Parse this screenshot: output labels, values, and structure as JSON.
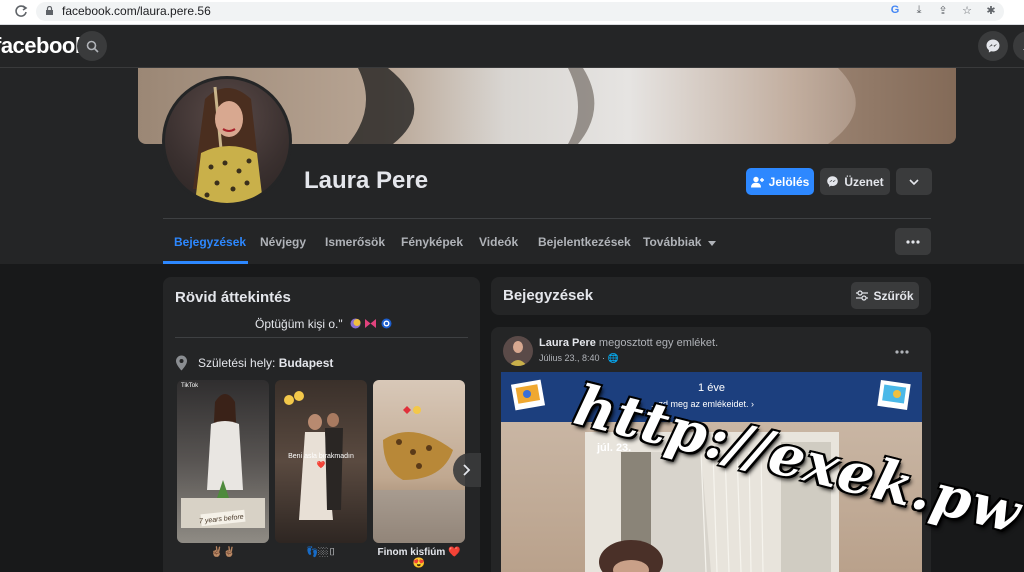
{
  "browser": {
    "url": "facebook.com/laura.pere.56",
    "icons": [
      "google-g-icon",
      "download-icon",
      "share-icon",
      "star-icon",
      "extension-icon"
    ]
  },
  "nav": {
    "logo": "facebook"
  },
  "profile": {
    "name": "Laura Pere",
    "add_friend_label": "Jelölés",
    "message_label": "Üzenet"
  },
  "tabs": [
    {
      "label": "Bejegyzések",
      "active": true
    },
    {
      "label": "Névjegy"
    },
    {
      "label": "Ismerősök"
    },
    {
      "label": "Fényképek"
    },
    {
      "label": "Videók"
    },
    {
      "label": "Bejelentkezések"
    },
    {
      "label": "Továbbiak"
    }
  ],
  "intro": {
    "title": "Rövid áttekintés",
    "bio": "Öptüğüm kişi o.\"",
    "birthplace_prefix": "Születési hely: ",
    "birthplace_value": "Budapest",
    "featured": [
      {
        "tag": "TikTok",
        "overlay": "7 years before",
        "caption": "✌🏽✌🏽"
      },
      {
        "overlay": "Beni asla bırakmadın ❤️",
        "caption": "👣🏼▯"
      },
      {
        "caption": "Finom kisfiúm ❤️😍"
      }
    ]
  },
  "posts": {
    "title": "Bejegyzések",
    "filter_label": "Szűrők",
    "post": {
      "author": "Laura Pere",
      "action": " megosztott egy emléket.",
      "meta": "Július 23., 8:40 · 🌐",
      "memory_years": "1 éve",
      "memory_sub": "...zd meg az emlékeidet. ›",
      "memory_date": "júl. 23."
    }
  },
  "watermark": "http://exek.pw",
  "colors": {
    "accent": "#2d88ff",
    "surface": "#242526",
    "background": "#18191a",
    "memory_banner": "#1c3f7e"
  }
}
